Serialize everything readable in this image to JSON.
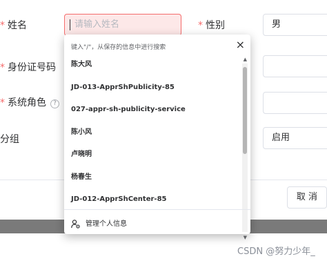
{
  "form": {
    "name_label": "姓名",
    "name_placeholder": "请输入姓名",
    "gender_label": "性别",
    "gender_value": "男",
    "id_label": "身份证号码",
    "role_label": "系统角色",
    "role_help": "?",
    "group_label": "分组",
    "status_value": "启用",
    "required_mark": "*"
  },
  "autocomplete": {
    "hint": "键入\"/\"，从保存的信息中进行搜索",
    "close": "×",
    "items": [
      "陈大风",
      "JD-013-ApprShPublicity-85",
      "027-appr-sh-publicity-service",
      "陈小风",
      "卢晓明",
      "杨春生",
      "JD-012-ApprShCenter-85"
    ],
    "manage_label": "管理个人信息",
    "scroll_up": "▲",
    "scroll_down": "▼"
  },
  "footer": {
    "cancel_label": "取 消"
  },
  "watermark": "CSDN @努力少年_",
  "colors": {
    "error_border": "#f56c6c",
    "error_bg": "#fde8e8",
    "required": "#f56c6c"
  }
}
